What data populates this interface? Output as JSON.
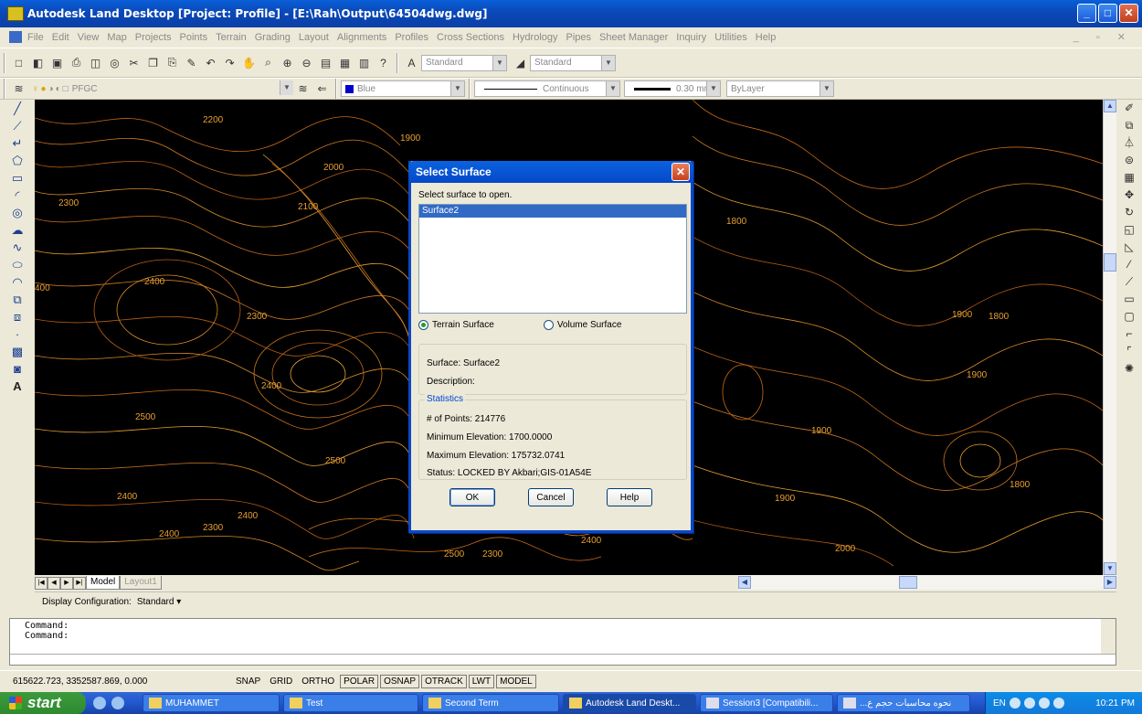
{
  "window": {
    "title": "Autodesk Land Desktop [Project: Profile] - [E:\\Rah\\Output\\64504dwg.dwg]"
  },
  "menu": [
    "File",
    "Edit",
    "View",
    "Map",
    "Projects",
    "Points",
    "Terrain",
    "Grading",
    "Layout",
    "Alignments",
    "Profiles",
    "Cross Sections",
    "Hydrology",
    "Pipes",
    "Sheet Manager",
    "Inquiry",
    "Utilities",
    "Help"
  ],
  "toolbar": {
    "text_style": "Standard",
    "dim_style": "Standard",
    "layer": "PFGC",
    "color": "Blue",
    "linetype": "Continuous",
    "lineweight": "0.30 mm",
    "plotstyle": "ByLayer"
  },
  "contour_labels": [
    "2200",
    "1900",
    "2000",
    "2300",
    "2100",
    "2400",
    "400",
    "2300",
    "2400",
    "2500",
    "2500",
    "2400",
    "2400",
    "2300",
    "2400",
    "2500",
    "2300",
    "2400",
    "1800",
    "1900",
    "1800",
    "1800",
    "1900",
    "1900",
    "2000",
    "1900"
  ],
  "layout_tabs": [
    "Model",
    "Layout1"
  ],
  "display_config": {
    "label": "Display Configuration:",
    "value": "Standard ▾"
  },
  "command": {
    "line1": "Command:",
    "line2": "Command:"
  },
  "status": {
    "coords": "615622.723, 3352587.869, 0.000",
    "buttons": [
      "SNAP",
      "GRID",
      "ORTHO",
      "POLAR",
      "OSNAP",
      "OTRACK",
      "LWT",
      "MODEL"
    ]
  },
  "dialog": {
    "title": "Select Surface",
    "prompt": "Select surface to open.",
    "surfaces": [
      "Surface2"
    ],
    "radio_terrain": "Terrain Surface",
    "radio_volume": "Volume Surface",
    "surface_line": "Surface: Surface2",
    "description_line": "Description:",
    "stats_legend": "Statistics",
    "points_line": "# of Points: 214776",
    "min_line": "Minimum Elevation: 1700.0000",
    "max_line": "Maximum Elevation: 175732.0741",
    "status_line": "Status: LOCKED BY Akbari;GIS-01A54E",
    "ok": "OK",
    "cancel": "Cancel",
    "help": "Help"
  },
  "taskbar": {
    "start": "start",
    "tasks": [
      "MUHAMMET",
      "Test",
      "Second Term",
      "Autodesk Land Deskt...",
      "Session3 [Compatibili...",
      "...نحوه محاسبات حجم ع"
    ],
    "lang": "EN",
    "clock": "10:21 PM"
  },
  "colors": {
    "contour": "#d07a20",
    "contour_light": "#e8a030",
    "selection": "#316ac5"
  }
}
